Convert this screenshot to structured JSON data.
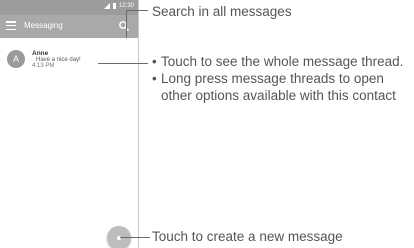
{
  "status": {
    "time": "12:30"
  },
  "toolbar": {
    "title": "Messaging"
  },
  "thread": {
    "avatar_letter": "A",
    "contact": "Anne",
    "preview": "Have a nice day!",
    "time": "4:13 PM"
  },
  "annotations": {
    "search": "Search in all messages",
    "thread_tips": [
      "Touch to see the whole message thread.",
      "Long press message threads to open other options available with this contact"
    ],
    "fab": "Touch to create a new message"
  },
  "icons": [
    "menu-icon",
    "search-icon",
    "signal-icon",
    "battery-icon",
    "add-message-icon"
  ]
}
